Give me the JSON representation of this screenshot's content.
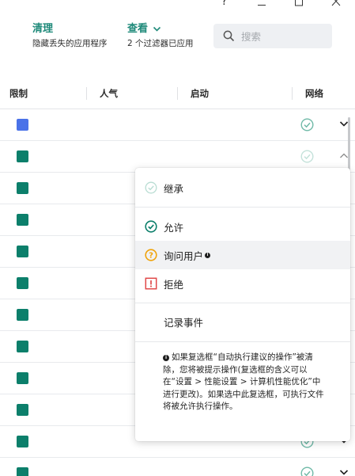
{
  "window": {
    "help_glyph": "?"
  },
  "toolbar": {
    "clean": {
      "title": "清理",
      "subtitle": "隐藏丢失的应用程序"
    },
    "view": {
      "title": "查看",
      "subtitle": "2 个过滤器已应用"
    },
    "search": {
      "placeholder": "搜索",
      "icon": "search-icon"
    }
  },
  "table": {
    "columns": [
      "限制",
      "人气",
      "启动",
      "网络"
    ],
    "rows": [
      {
        "icon_color": "#4a72e8",
        "network": "check-circle-icon",
        "expand": "chevron-down-icon"
      },
      {
        "icon_color": "#0c7f6b",
        "network": "check-circle-light-icon",
        "expand": "chevron-up-icon"
      },
      {
        "icon_color": "#0c7f6b"
      },
      {
        "icon_color": "#0c7f6b"
      },
      {
        "icon_color": "#0c7f6b"
      },
      {
        "icon_color": "#0c7f6b"
      },
      {
        "icon_color": "#0c7f6b"
      },
      {
        "icon_color": "#0c7f6b"
      },
      {
        "icon_color": "#0c7f6b"
      },
      {
        "icon_color": "#0c7f6b"
      },
      {
        "icon_color": "#0c7f6b",
        "network": "check-circle-icon",
        "expand": "chevron-down-icon"
      },
      {
        "icon_color": "#0c7f6b",
        "network": "check-circle-icon",
        "expand": "chevron-down-icon"
      }
    ]
  },
  "menu": {
    "items": [
      {
        "label": "继承",
        "icon": "check-circle-light-icon"
      },
      {
        "label": "允许",
        "icon": "check-circle-icon"
      },
      {
        "label": "询问用户",
        "icon": "question-circle-icon",
        "info": "i"
      },
      {
        "label": "拒绝",
        "icon": "deny-icon"
      },
      {
        "label": "记录事件"
      }
    ],
    "note": "如果复选框“自动执行建议的操作”被清除，您将被提示操作(复选框的含义可以在“设置 > 性能设置 > 计算机性能优化”中进行更改)。如果选中此复选框，可执行文件将被允许执行操作。",
    "note_icon": "i"
  },
  "colors": {
    "accent": "#1f8a7a",
    "app_green": "#0c7f6b",
    "app_blue": "#4a72e8",
    "warning": "#f0a30a",
    "deny": "#e04848"
  }
}
